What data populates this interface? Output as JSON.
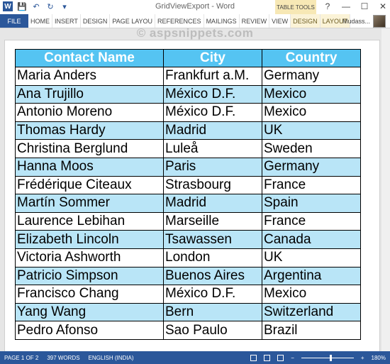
{
  "window": {
    "title": "GridViewExport - Word",
    "contextual_tab": "TABLE TOOLS",
    "user_name": "Mudass...",
    "controls": {
      "help": "?",
      "minimize": "—",
      "maximize": "☐",
      "close": "✕"
    }
  },
  "ribbon": {
    "file_tab": "FILE",
    "tabs": [
      "HOME",
      "INSERT",
      "DESIGN",
      "PAGE LAYOU",
      "REFERENCES",
      "MAILINGS",
      "REVIEW",
      "VIEW",
      "DESIGN",
      "LAYOUT"
    ]
  },
  "watermark": "© aspsnippets.com",
  "table": {
    "headers": [
      "Contact Name",
      "City",
      "Country"
    ],
    "rows": [
      [
        "Maria Anders",
        "Frankfurt a.M.",
        "Germany"
      ],
      [
        "Ana Trujillo",
        "México D.F.",
        "Mexico"
      ],
      [
        "Antonio Moreno",
        "México D.F.",
        "Mexico"
      ],
      [
        "Thomas Hardy",
        "Madrid",
        "UK"
      ],
      [
        "Christina Berglund",
        "Luleå",
        "Sweden"
      ],
      [
        "Hanna Moos",
        "Paris",
        "Germany"
      ],
      [
        "Frédérique Citeaux",
        "Strasbourg",
        "France"
      ],
      [
        "Martín Sommer",
        "Madrid",
        "Spain"
      ],
      [
        "Laurence Lebihan",
        "Marseille",
        "France"
      ],
      [
        "Elizabeth Lincoln",
        "Tsawassen",
        "Canada"
      ],
      [
        "Victoria Ashworth",
        "London",
        "UK"
      ],
      [
        "Patricio Simpson",
        "Buenos Aires",
        "Argentina"
      ],
      [
        "Francisco Chang",
        "México D.F.",
        "Mexico"
      ],
      [
        "Yang Wang",
        "Bern",
        "Switzerland"
      ],
      [
        "Pedro Afonso",
        "Sao Paulo",
        "Brazil"
      ]
    ]
  },
  "status": {
    "page": "PAGE 1 OF 2",
    "words": "397 WORDS",
    "language": "ENGLISH (INDIA)",
    "zoom_minus": "−",
    "zoom_plus": "+",
    "zoom": "180%"
  },
  "colors": {
    "accent": "#2b579a",
    "header_bg": "#55c4f2",
    "alt_row_bg": "#b9e5f7"
  }
}
